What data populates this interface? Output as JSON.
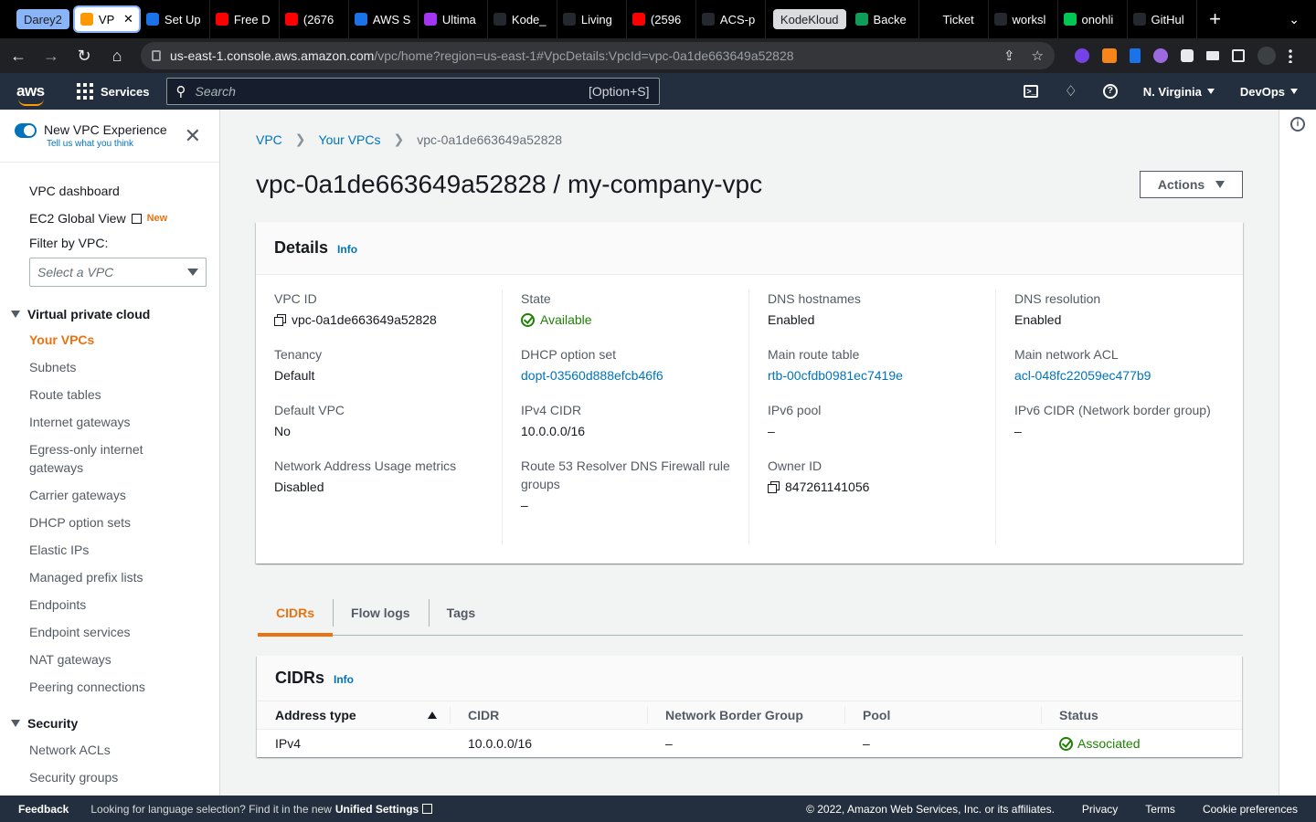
{
  "browser": {
    "tab_group": {
      "label": "Darey2",
      "color": "#8ab4f8"
    },
    "tabs": [
      {
        "label": "VP",
        "icon": "aws-box-icon",
        "color": "#ff9900",
        "active": true
      },
      {
        "label": "Set Up",
        "icon": "app-icon",
        "color": "#1a73e8"
      },
      {
        "label": "Free D",
        "icon": "youtube-icon",
        "color": "#ff0000"
      },
      {
        "label": "(2676",
        "icon": "youtube-icon",
        "color": "#ff0000"
      },
      {
        "label": "AWS S",
        "icon": "app-icon",
        "color": "#1a73e8"
      },
      {
        "label": "Ultima",
        "icon": "udemy-icon",
        "color": "#a435f0"
      },
      {
        "label": "Kode_",
        "icon": "github-icon",
        "color": "#24292f"
      },
      {
        "label": "Living",
        "icon": "github-icon",
        "color": "#24292f"
      },
      {
        "label": "(2596",
        "icon": "youtube-icon",
        "color": "#ff0000"
      },
      {
        "label": "ACS-p",
        "icon": "github-icon",
        "color": "#24292f"
      }
    ],
    "tab_group2": {
      "label": "KodeKloud",
      "color": "#dadce0"
    },
    "tabs2": [
      {
        "label": "Backe",
        "icon": "sheets-icon",
        "color": "#0f9d58"
      },
      {
        "label": "Ticket",
        "icon": "notion-icon",
        "color": "#000000"
      },
      {
        "label": "worksl",
        "icon": "github-icon",
        "color": "#24292f"
      },
      {
        "label": "onohli",
        "icon": "n-icon",
        "color": "#00c853"
      },
      {
        "label": "GitHul",
        "icon": "github-icon",
        "color": "#24292f"
      }
    ],
    "url_host": "us-east-1.console.aws.amazon.com",
    "url_path": "/vpc/home?region=us-east-1#VpcDetails:VpcId=vpc-0a1de663649a52828"
  },
  "aws_nav": {
    "logo": "aws",
    "services": "Services",
    "search_placeholder": "Search",
    "search_hint": "[Option+S]",
    "region": "N. Virginia",
    "account": "DevOps"
  },
  "sidebar": {
    "new_experience": "New VPC Experience",
    "feedback": "Tell us what you think",
    "top_links": [
      "VPC dashboard",
      "EC2 Global View"
    ],
    "new_badge": "New",
    "filter_label": "Filter by VPC:",
    "filter_placeholder": "Select a VPC",
    "section_vpc": "Virtual private cloud",
    "vpc_items": [
      "Your VPCs",
      "Subnets",
      "Route tables",
      "Internet gateways",
      "Egress-only internet gateways",
      "Carrier gateways",
      "DHCP option sets",
      "Elastic IPs",
      "Managed prefix lists",
      "Endpoints",
      "Endpoint services",
      "NAT gateways",
      "Peering connections"
    ],
    "section_security": "Security",
    "security_items": [
      "Network ACLs",
      "Security groups"
    ]
  },
  "breadcrumb": [
    "VPC",
    "Your VPCs",
    "vpc-0a1de663649a52828"
  ],
  "page_title": "vpc-0a1de663649a52828 / my-company-vpc",
  "actions": "Actions",
  "details": {
    "title": "Details",
    "info": "Info",
    "columns": [
      [
        {
          "label": "VPC ID",
          "value": "vpc-0a1de663649a52828",
          "style": "copy"
        },
        {
          "label": "Tenancy",
          "value": "Default",
          "style": "plain"
        },
        {
          "label": "Default VPC",
          "value": "No",
          "style": "plain"
        },
        {
          "label": "Network Address Usage metrics",
          "value": "Disabled",
          "style": "plain"
        }
      ],
      [
        {
          "label": "State",
          "value": "Available",
          "style": "ok"
        },
        {
          "label": "DHCP option set",
          "value": "dopt-03560d888efcb46f6",
          "style": "link"
        },
        {
          "label": "IPv4 CIDR",
          "value": "10.0.0.0/16",
          "style": "plain"
        },
        {
          "label": "Route 53 Resolver DNS Firewall rule groups",
          "value": "–",
          "style": "plain"
        }
      ],
      [
        {
          "label": "DNS hostnames",
          "value": "Enabled",
          "style": "plain"
        },
        {
          "label": "Main route table",
          "value": "rtb-00cfdb0981ec7419e",
          "style": "link"
        },
        {
          "label": "IPv6 pool",
          "value": "–",
          "style": "plain"
        },
        {
          "label": "Owner ID",
          "value": "847261141056",
          "style": "copy"
        }
      ],
      [
        {
          "label": "DNS resolution",
          "value": "Enabled",
          "style": "plain"
        },
        {
          "label": "Main network ACL",
          "value": "acl-048fc22059ec477b9",
          "style": "link"
        },
        {
          "label": "IPv6 CIDR (Network border group)",
          "value": "–",
          "style": "plain"
        }
      ]
    ]
  },
  "tabs": [
    "CIDRs",
    "Flow logs",
    "Tags"
  ],
  "cidrs": {
    "title": "CIDRs",
    "info": "Info",
    "headers": [
      "Address type",
      "CIDR",
      "Network Border Group",
      "Pool",
      "Status"
    ],
    "rows": [
      [
        "IPv4",
        "10.0.0.0/16",
        "–",
        "–",
        "Associated"
      ]
    ]
  },
  "footer": {
    "feedback": "Feedback",
    "lang_text": "Looking for language selection? Find it in the new",
    "lang_link": "Unified Settings",
    "copyright": "© 2022, Amazon Web Services, Inc. or its affiliates.",
    "links": [
      "Privacy",
      "Terms",
      "Cookie preferences"
    ]
  }
}
